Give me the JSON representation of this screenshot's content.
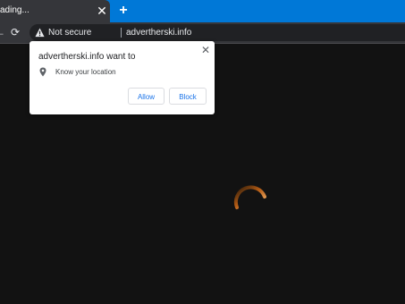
{
  "browser": {
    "tab_title": "ading...",
    "close_glyph": "✕",
    "new_tab_glyph": "+",
    "back_glyph": "←",
    "reload_glyph": "⟳",
    "security_label": "Not secure",
    "url": "advertherski.info",
    "accent_color": "#0078d7"
  },
  "permission_prompt": {
    "title": "advertherski.info want to",
    "permission": "Know your location",
    "allow_label": "Allow",
    "block_label": "Block",
    "close_glyph": "✕",
    "button_color": "#1a73e8"
  },
  "page": {
    "background": "#121212",
    "spinner_color": "#f08a2a",
    "spinner_icon": "loading-spinner-icon"
  }
}
